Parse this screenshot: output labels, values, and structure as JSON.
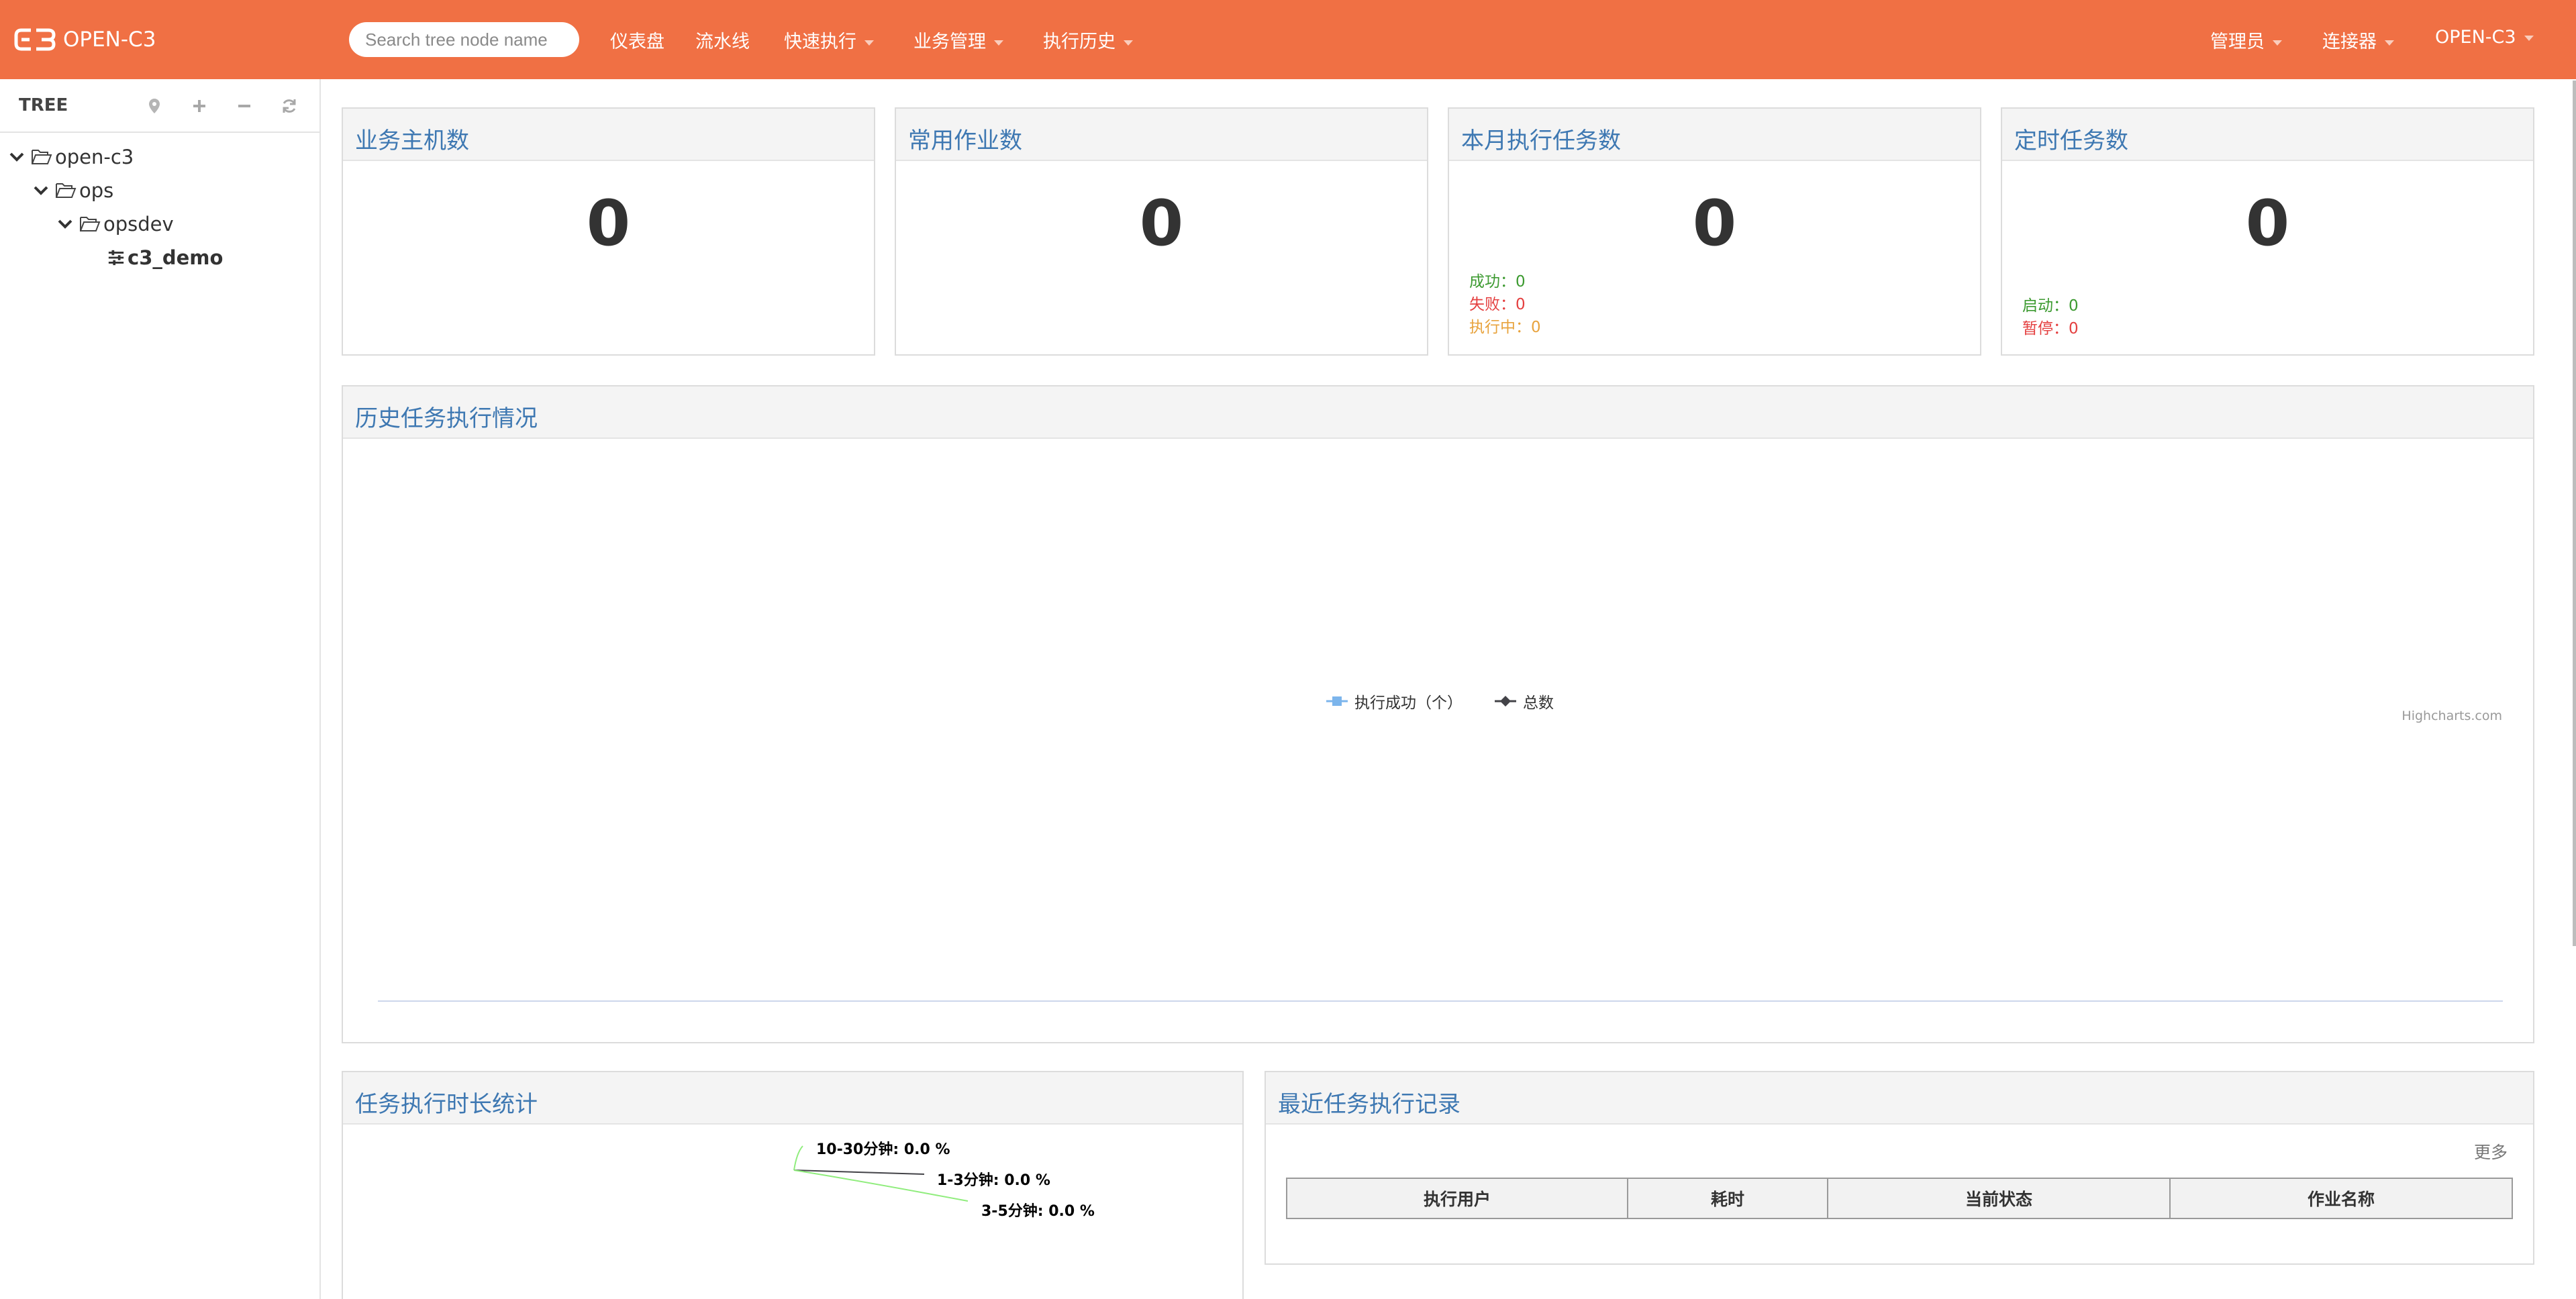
{
  "navbar": {
    "brand": "OPEN-C3",
    "search_placeholder": "Search tree node name",
    "menu": [
      {
        "label": "仪表盘"
      },
      {
        "label": "流水线"
      },
      {
        "label": "快速执行"
      },
      {
        "label": "业务管理"
      },
      {
        "label": "执行历史"
      }
    ],
    "right_menu": [
      {
        "label": "管理员"
      },
      {
        "label": "连接器"
      },
      {
        "label": "OPEN-C3"
      }
    ]
  },
  "sidebar": {
    "title": "TREE",
    "tools": [
      "locate-icon",
      "plus-icon",
      "minus-icon",
      "refresh-icon"
    ],
    "nodes": [
      {
        "label": "open-c3"
      },
      {
        "label": "ops"
      },
      {
        "label": "opsdev"
      },
      {
        "label": "c3_demo"
      }
    ]
  },
  "cards": [
    {
      "title": "业务主机数",
      "value": "0"
    },
    {
      "title": "常用作业数",
      "value": "0"
    },
    {
      "title": "本月执行任务数",
      "value": "0",
      "stats": [
        "成功：0",
        "失败：0",
        "执行中：0"
      ]
    },
    {
      "title": "定时任务数",
      "value": "0",
      "stats": [
        "启动：0",
        "暂停：0"
      ]
    }
  ],
  "history_chart": {
    "title": "历史任务执行情况",
    "legend": [
      "执行成功（个）",
      "总数"
    ],
    "credit": "Highcharts.com"
  },
  "duration_panel": {
    "title": "任务执行时长统计",
    "labels": [
      "10-30分钟: 0.0 %",
      "1-3分钟: 0.0 %",
      "3-5分钟: 0.0 %"
    ]
  },
  "recent_panel": {
    "title": "最近任务执行记录",
    "more": "更多",
    "columns": [
      "执行用户",
      "耗时",
      "当前状态",
      "作业名称"
    ]
  },
  "colors": {
    "navbar": "#f07044",
    "title_blue": "#3e78b2",
    "success_green": "#3c9a30",
    "fail_red": "#e43f3f",
    "running_orange": "#e8a33d"
  },
  "chart_data": {
    "type": "line",
    "categories": [],
    "series": [
      {
        "name": "执行成功（个）",
        "values": []
      },
      {
        "name": "总数",
        "values": []
      }
    ],
    "title": "",
    "xlabel": "",
    "ylabel": ""
  }
}
